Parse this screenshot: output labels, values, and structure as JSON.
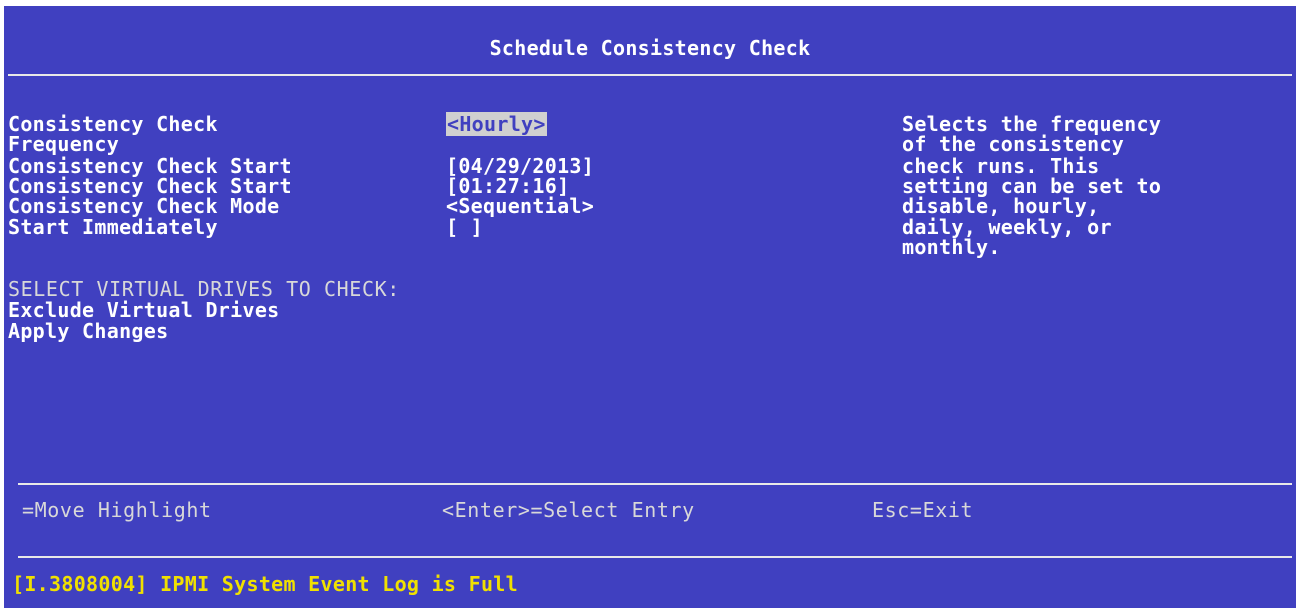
{
  "title": "Schedule Consistency Check",
  "fields": [
    {
      "label": "Consistency Check",
      "value": "<Hourly>"
    },
    {
      "label": "Frequency",
      "value": ""
    },
    {
      "label": "Consistency Check Start",
      "value": "[04/29/2013]"
    },
    {
      "label": "Consistency Check Start",
      "value": "[01:27:16]"
    },
    {
      "label": "Consistency Check Mode",
      "value": "<Sequential>"
    },
    {
      "label": "Start Immediately",
      "value": "[ ]"
    }
  ],
  "section_header": "SELECT VIRTUAL DRIVES TO CHECK:",
  "actions": [
    "Exclude Virtual Drives",
    "Apply Changes"
  ],
  "help_text": [
    "Selects the frequency",
    "of the consistency",
    "check runs. This",
    "setting can be set to",
    "disable, hourly,",
    "daily, weekly, or",
    "monthly."
  ],
  "footer_hints": [
    "=Move Highlight",
    "<Enter>=Select Entry",
    "Esc=Exit"
  ],
  "status_message": "[I.3808004] IPMI System Event Log is Full",
  "colors": {
    "background": "#4040c0",
    "text": "#ffffff",
    "dim_text": "#d8d8d8",
    "highlight_bg": "#d0d0d0",
    "status_text": "#f0e000"
  }
}
